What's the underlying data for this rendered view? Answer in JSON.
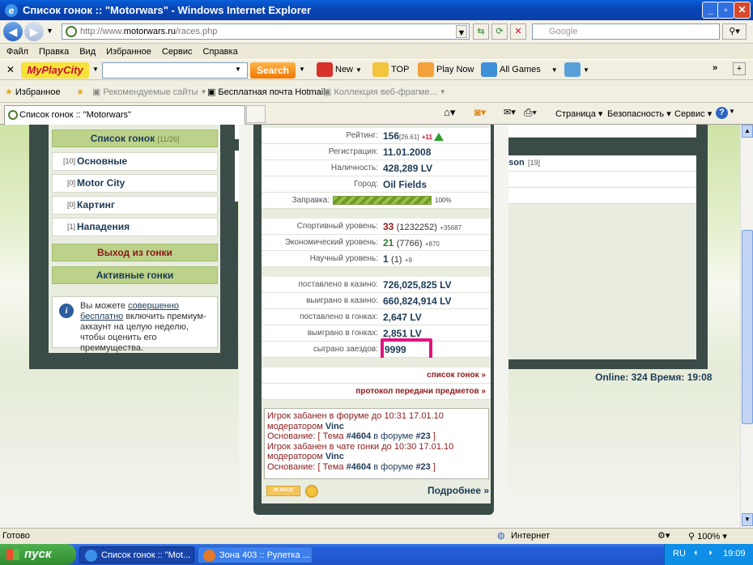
{
  "window": {
    "title": "Список гонок :: \"Motorwars\" - Windows Internet Explorer"
  },
  "address": {
    "url_prefix": "http://www.",
    "url_domain": "motorwars.ru",
    "url_path": "/races.php",
    "search_placeholder": "Google"
  },
  "menu": [
    "Файл",
    "Правка",
    "Вид",
    "Избранное",
    "Сервис",
    "Справка"
  ],
  "toolbar": {
    "logo": "MyPlayCity",
    "search_button": "Search",
    "new": "New",
    "top": "TOP",
    "play_now": "Play Now",
    "all_games": "All Games"
  },
  "favorites": {
    "label": "Избранное",
    "items": [
      "Рекомендуемые сайты",
      "Бесплатная почта Hotmail",
      "Коллекция веб-фрагме..."
    ]
  },
  "tab": {
    "title": "Список гонок :: \"Motorwars\""
  },
  "commands": {
    "page": "Страница",
    "security": "Безопасность",
    "service": "Сервис"
  },
  "left": {
    "header": "Список гонок",
    "header_count": "[11/26]",
    "items": [
      {
        "count": "[10]",
        "label": "Основные"
      },
      {
        "count": "[0]",
        "label": "Motor City"
      },
      {
        "count": "[0]",
        "label": "Картинг"
      },
      {
        "count": "[1]",
        "label": "Нападения"
      }
    ],
    "exit": "Выход из гонки",
    "active": "Активные гонки",
    "info_pre": "Вы можете ",
    "info_link1": "совершенно",
    "info_link2": "бесплатно",
    "info_post": " включить премиум-аккаунт на целую неделю, чтобы оценить его преимущества."
  },
  "stats": {
    "rating_label": "Рейтинг:",
    "rating_value": "156",
    "rating_sub": "[26.61]",
    "rating_delta": "+11",
    "reg_label": "Регистрация:",
    "reg_value": "11.01.2008",
    "cash_label": "Наличность:",
    "cash_value": "428,289 LV",
    "city_label": "Город:",
    "city_value": "Oil Fields",
    "fuel_label": "Заправка:",
    "fuel_pct_text": "100%",
    "fuel_fraction": 1.0,
    "sport_label": "Спортивный уровень:",
    "sport_level": "33",
    "sport_points": "(1232252)",
    "sport_delta": "+35687",
    "econ_label": "Экономический уровень:",
    "econ_level": "21",
    "econ_points": "(7766)",
    "econ_delta": "+870",
    "sci_label": "Научный уровень:",
    "sci_level": "1",
    "sci_points": "(1)",
    "sci_delta": "+9",
    "casino_bet_label": "поставлено в казино:",
    "casino_bet_value": "726,025,825 LV",
    "casino_win_label": "выиграно в казино:",
    "casino_win_value": "660,824,914 LV",
    "race_bet_label": "поставлено в гонках:",
    "race_bet_value": "2,647 LV",
    "race_win_label": "выиграно в гонках:",
    "race_win_value": "2,851 LV",
    "races_label": "сыграно заездов:",
    "races_value": "9999",
    "link1": "список гонок »",
    "link2": "протокол передачи предметов »"
  },
  "log": {
    "l1a": "Игрок забанен в форуме до 10:31 17.01.10",
    "l1b": "модератором ",
    "l1mod": "Vinc",
    "l1c_pre": "Основание: [ Тема ",
    "l1topic": "#4604",
    "l1c_mid": " в форуме ",
    "l1forum": "#23",
    "l1c_post": " ]",
    "l2a": "Игрок забанен в чате гонки до 10:30 17.01.10",
    "l2b": "модератором ",
    "l2mod": "Vinc",
    "l2c_pre": "Основание: [ Тема ",
    "l2topic": "#4604",
    "l2c_mid": " в форуме ",
    "l2forum": "#23",
    "l2c_post": " ]",
    "badge": "IN RACE",
    "more": "Подробнее »"
  },
  "right": {
    "player": "yson",
    "player_num": "[19]",
    "online": "Online: 324  Время: 19:08"
  },
  "status": {
    "ready": "Готово",
    "zone": "Интернет",
    "zoom": "100%"
  },
  "taskbar": {
    "start": "пуск",
    "task1": "Список гонок :: \"Mot...",
    "task2": "Зона 403 :: Рулетка ...",
    "lang": "RU",
    "time": "19:09"
  }
}
